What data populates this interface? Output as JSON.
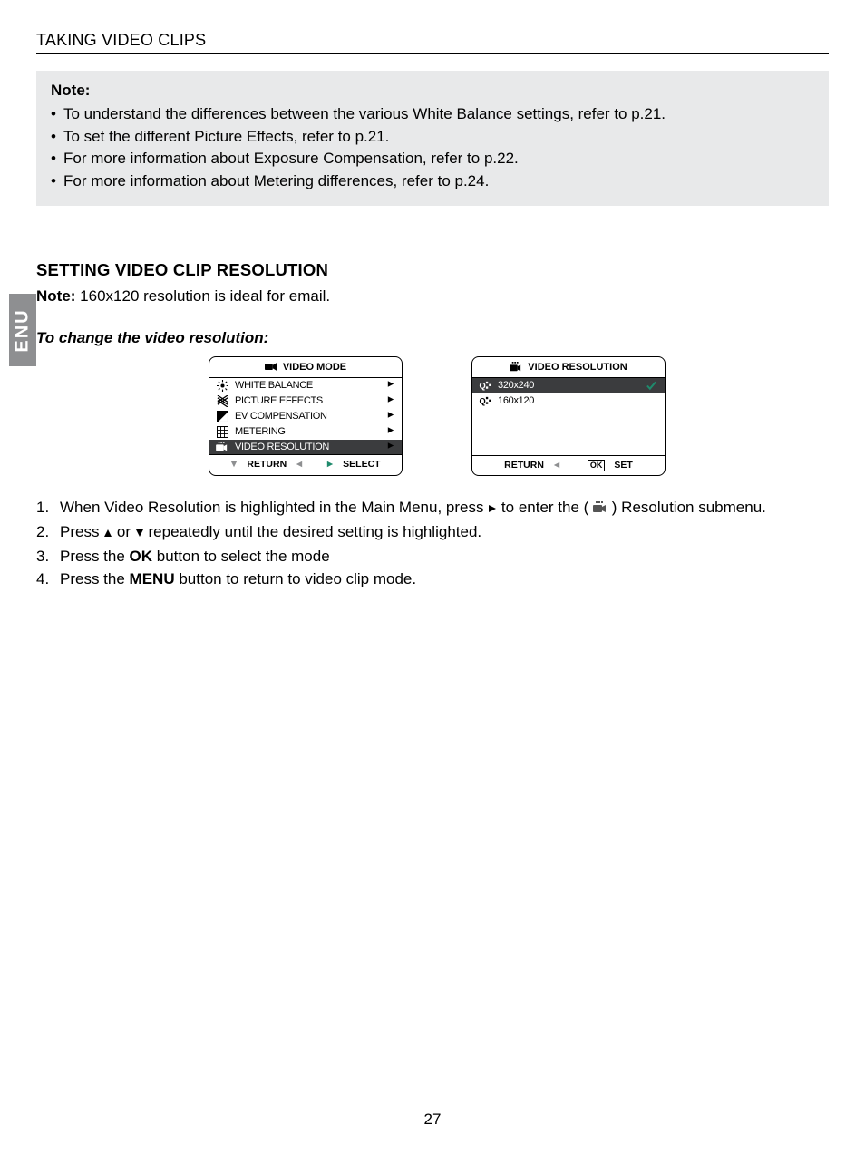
{
  "section_title": "TAKING VIDEO CLIPS",
  "side_tab": "ENU",
  "note_box": {
    "label": "Note:",
    "items": [
      "To understand the differences between the various White Balance settings, refer to p.21.",
      "To set the different Picture Effects, refer to p.21.",
      "For more information about Exposure Compensation, refer to p.22.",
      "For more information about Metering differences, refer to p.24."
    ]
  },
  "heading": "SETTING VIDEO CLIP RESOLUTION",
  "note_inline": {
    "label": "Note:",
    "text": " 160x120 resolution is ideal for email."
  },
  "subhead": "To change the video resolution:",
  "screen_mode": {
    "title": "VIDEO MODE",
    "items": [
      {
        "icon": "wb-icon",
        "label": "WHITE BALANCE",
        "selected": false
      },
      {
        "icon": "fx-icon",
        "label": "PICTURE EFFECTS",
        "selected": false
      },
      {
        "icon": "ev-icon",
        "label": "EV COMPENSATION",
        "selected": false
      },
      {
        "icon": "meter-icon",
        "label": "METERING",
        "selected": false
      },
      {
        "icon": "vres-icon",
        "label": "VIDEO RESOLUTION",
        "selected": true
      }
    ],
    "footer": {
      "left": "RETURN",
      "right": "SELECT"
    }
  },
  "screen_res": {
    "title": "VIDEO RESOLUTION",
    "items": [
      {
        "icon": "q-icon",
        "label": "320x240",
        "selected": true,
        "checked": true
      },
      {
        "icon": "q-icon",
        "label": "160x120",
        "selected": false,
        "checked": false
      }
    ],
    "footer": {
      "left": "RETURN",
      "right": "SET"
    }
  },
  "steps": {
    "s1a": "When Video Resolution is highlighted in the Main Menu, press ",
    "s1b": " to enter the ( ",
    "s1c": " ) Resolution submenu.",
    "s2a": "Press ",
    "s2b": "  or ",
    "s2c": "  repeatedly until the desired setting is highlighted.",
    "s3a": "Press the ",
    "s3b": "OK",
    "s3c": " button to select the mode",
    "s4a": "Press the ",
    "s4b": "MENU",
    "s4c": " button to return to video clip mode."
  },
  "page_number": "27"
}
